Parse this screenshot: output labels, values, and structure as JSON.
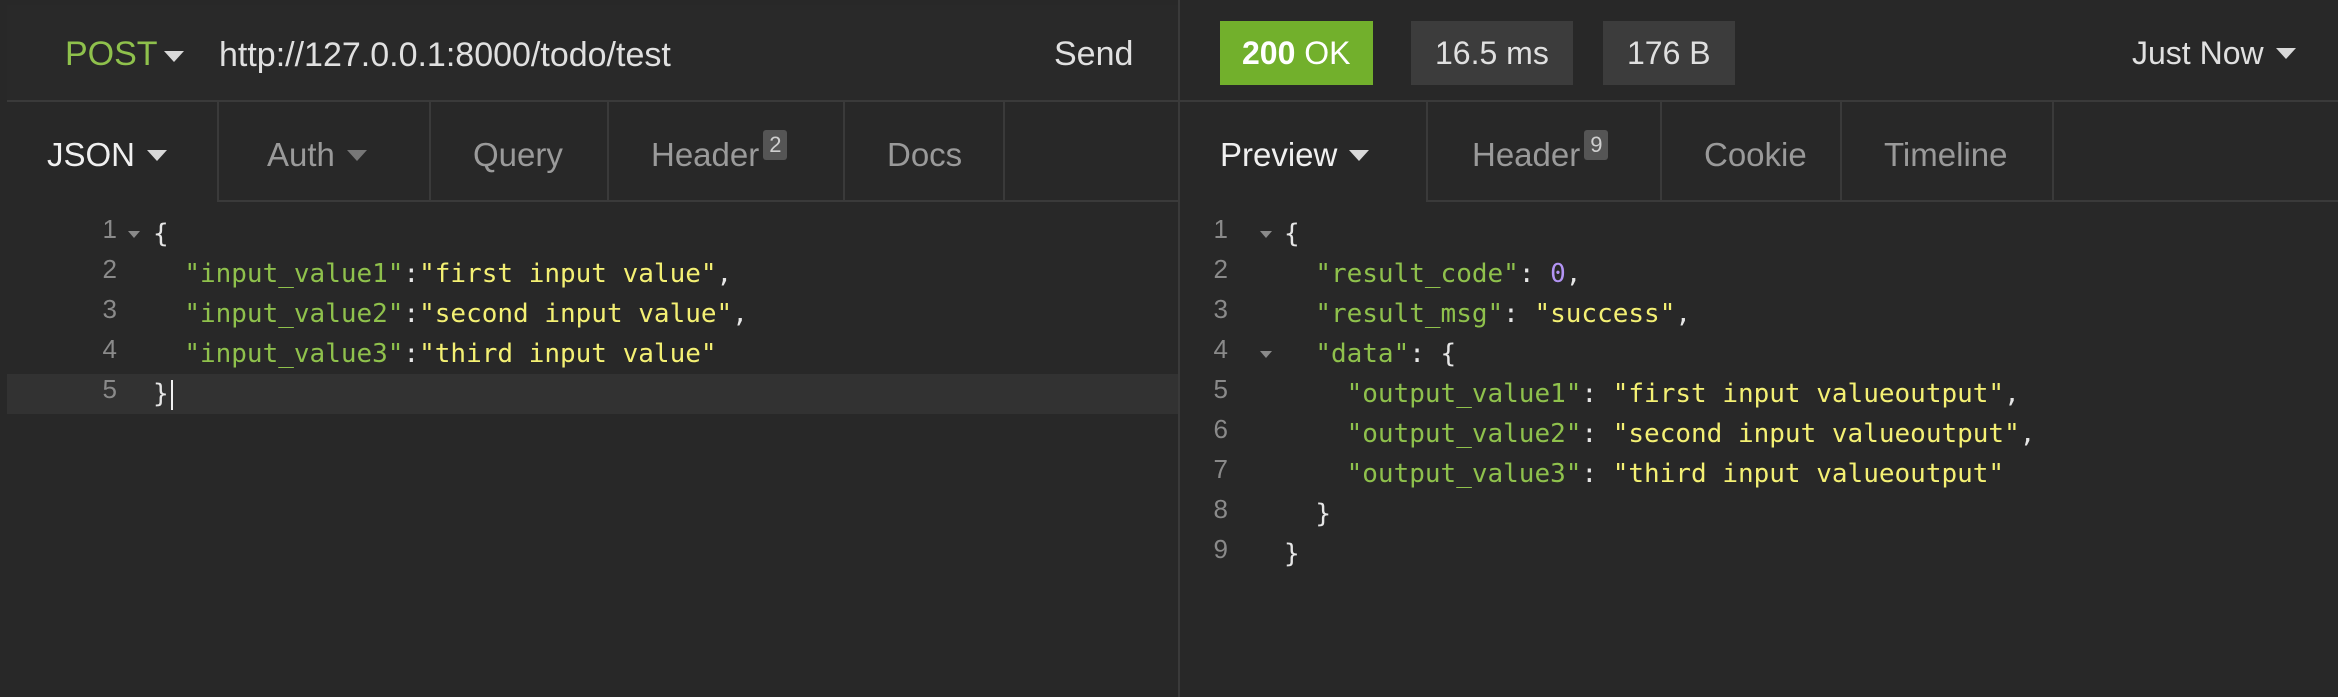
{
  "request": {
    "method": "POST",
    "url": "http://127.0.0.1:8000/todo/test",
    "send_label": "Send",
    "tabs": [
      {
        "label": "JSON"
      },
      {
        "label": "Auth"
      },
      {
        "label": "Query"
      },
      {
        "label": "Header",
        "badge": "2"
      },
      {
        "label": "Docs"
      }
    ],
    "body_lines": [
      "1",
      "2",
      "3",
      "4",
      "5"
    ],
    "body": {
      "k1": "\"input_value1\"",
      "v1": "\"first input value\"",
      "k2": "\"input_value2\"",
      "v2": "\"second input value\"",
      "k3": "\"input_value3\"",
      "v3": "\"third input value\""
    }
  },
  "response": {
    "status_code": "200",
    "status_text": "OK",
    "time": "16.5 ms",
    "size": "176 B",
    "history": "Just Now",
    "tabs": [
      {
        "label": "Preview"
      },
      {
        "label": "Header",
        "badge": "9"
      },
      {
        "label": "Cookie"
      },
      {
        "label": "Timeline"
      }
    ],
    "body_lines": [
      "1",
      "2",
      "3",
      "4",
      "5",
      "6",
      "7",
      "8",
      "9"
    ],
    "body": {
      "result_code_key": "\"result_code\"",
      "result_code_val": "0",
      "result_msg_key": "\"result_msg\"",
      "result_msg_val": "\"success\"",
      "data_key": "\"data\"",
      "o1k": "\"output_value1\"",
      "o1v": "\"first input valueoutput\"",
      "o2k": "\"output_value2\"",
      "o2v": "\"second input valueoutput\"",
      "o3k": "\"output_value3\"",
      "o3v": "\"third input valueoutput\""
    }
  },
  "colors": {
    "method": "#8fc14c",
    "status_ok": "#72b02c",
    "json_key": "#8fc14c",
    "json_string": "#f4f073",
    "json_number": "#b394f4"
  }
}
